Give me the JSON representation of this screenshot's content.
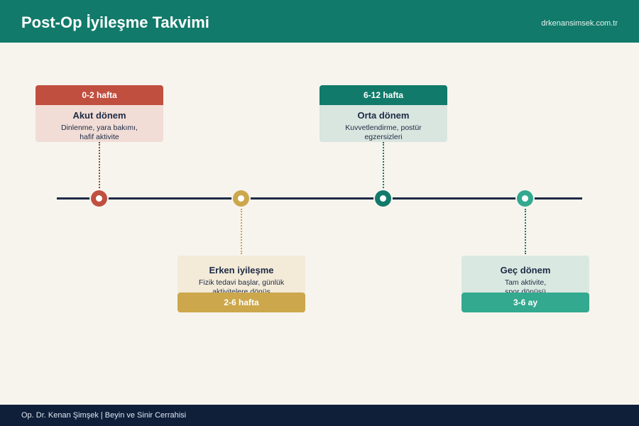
{
  "header": {
    "title": "Post-Op İyileşme Takvimi",
    "url": "drkenansimsek.com.tr"
  },
  "footer": {
    "text": "Op. Dr. Kenan Şimşek | Beyin ve Sinir Cerrahisi"
  },
  "colors": {
    "header_bg": "#117a6a",
    "footer_bg": "#0f1f3a",
    "line": "#1d2b45",
    "stage1": "#c14f3f",
    "stage2": "#cca74b",
    "stage3": "#117a6a",
    "stage4": "#33a98f"
  },
  "stages": [
    {
      "period": "0-2 hafta",
      "title": "Akut dönem",
      "description": "Dinlenme, yara bakımı, hafif aktivite",
      "color": "#c14f3f",
      "tint": "#f1dcd6"
    },
    {
      "period": "2-6 hafta",
      "title": "Erken iyileşme",
      "description": "Fizik tedavi başlar, günlük aktivitelere dönüş",
      "color": "#cca74b",
      "tint": "#f3ead8"
    },
    {
      "period": "6-12 hafta",
      "title": "Orta dönem",
      "description": "Kuvvetlendirme, postür egzersizleri",
      "color": "#117a6a",
      "tint": "#d9e5df"
    },
    {
      "period": "3-6 ay",
      "title": "Geç dönem",
      "description": "Tam aktivite, spor dönüşü",
      "color": "#33a98f",
      "tint": "#d9e9e1"
    }
  ]
}
